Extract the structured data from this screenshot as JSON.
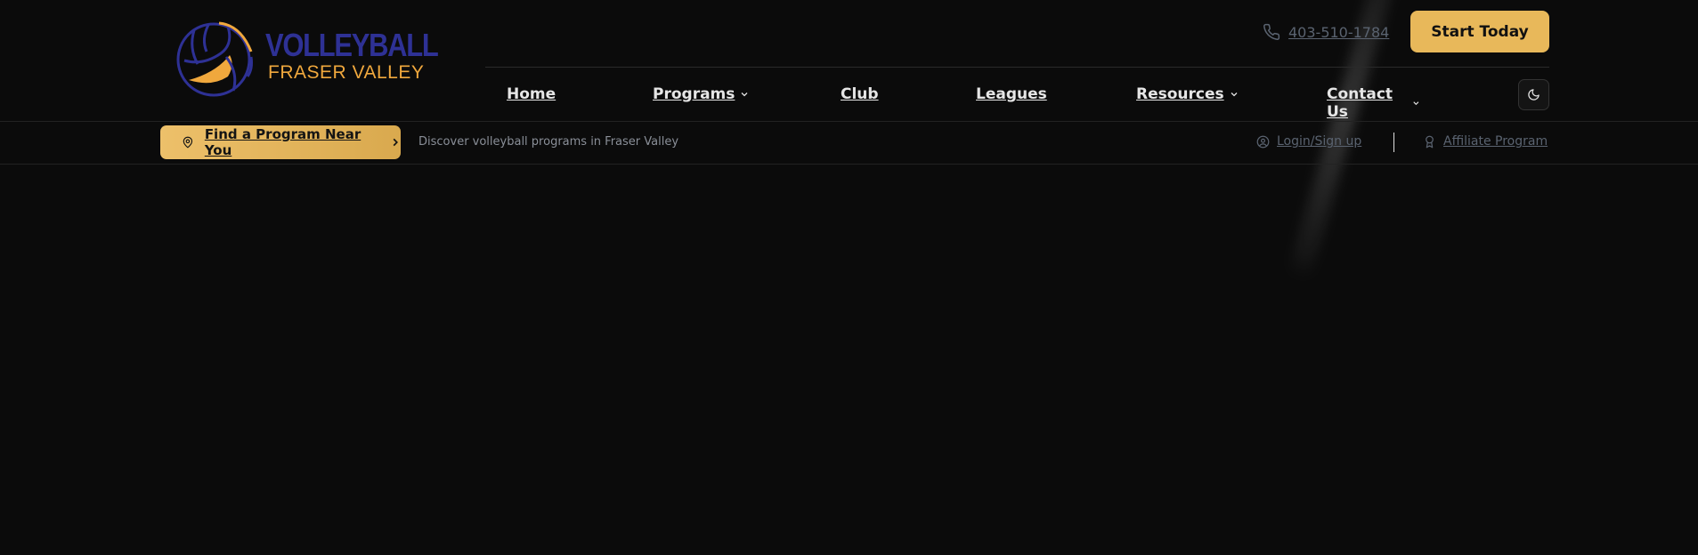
{
  "brand": {
    "name_line1": "VOLLEYBALL",
    "name_line2": "FRASER VALLEY",
    "colors": {
      "navy": "#2e3195",
      "gold": "#f0a83d",
      "accent": "#e8b85a",
      "background": "#0b0b0b"
    }
  },
  "header": {
    "phone": "403-510-1784",
    "cta_label": "Start Today",
    "theme_toggle_icon": "moon-icon"
  },
  "nav": {
    "items": [
      {
        "label": "Home",
        "has_dropdown": false
      },
      {
        "label": "Programs",
        "has_dropdown": true
      },
      {
        "label": "Club",
        "has_dropdown": false
      },
      {
        "label": "Leagues",
        "has_dropdown": false
      },
      {
        "label": "Resources",
        "has_dropdown": true
      },
      {
        "label": "Contact Us",
        "has_dropdown": true
      }
    ]
  },
  "subbar": {
    "find_label": "Find a Program Near You",
    "tagline": "Discover volleyball programs in Fraser Valley",
    "login_label": "Login/Sign up",
    "affiliate_label": "Affiliate Program"
  }
}
